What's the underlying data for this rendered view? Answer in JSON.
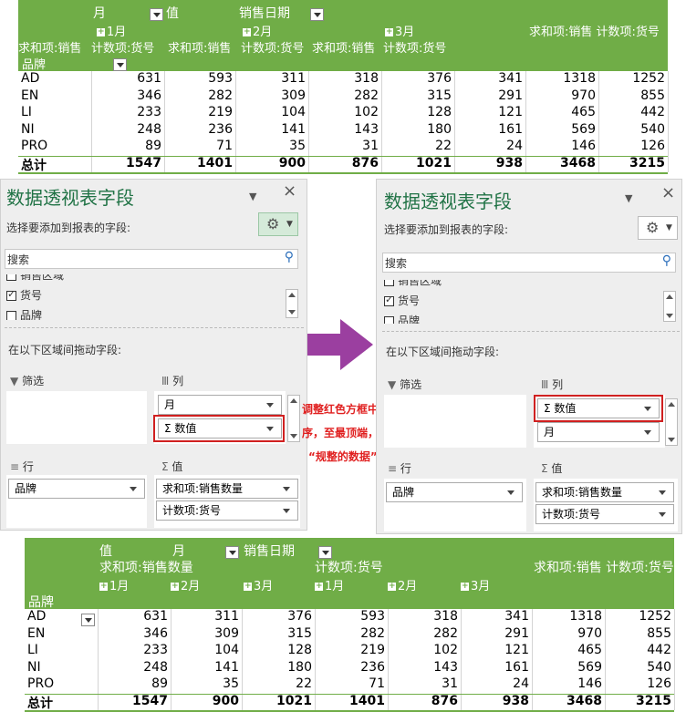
{
  "table1": {
    "header": {
      "month_label": "月",
      "value_label": "值",
      "date_label": "销售日期",
      "months": [
        "1月",
        "2月",
        "3月"
      ],
      "sub_sum": "求和项:销售",
      "sub_count": "计数项:货号",
      "total_sum_count": "求和项:销售 计数项:货号",
      "row_label": "品牌"
    },
    "rows": [
      {
        "brand": "AD",
        "values": [
          "631",
          "593",
          "311",
          "318",
          "376",
          "341",
          "1318",
          "1252"
        ]
      },
      {
        "brand": "EN",
        "values": [
          "346",
          "282",
          "309",
          "282",
          "315",
          "291",
          "970",
          "855"
        ]
      },
      {
        "brand": "LI",
        "values": [
          "233",
          "219",
          "104",
          "102",
          "128",
          "121",
          "465",
          "442"
        ]
      },
      {
        "brand": "NI",
        "values": [
          "248",
          "236",
          "141",
          "143",
          "180",
          "161",
          "569",
          "540"
        ]
      },
      {
        "brand": "PRO",
        "values": [
          "89",
          "71",
          "35",
          "31",
          "22",
          "24",
          "146",
          "126"
        ]
      }
    ],
    "total": {
      "label": "总计",
      "values": [
        "1547",
        "1401",
        "900",
        "876",
        "1021",
        "938",
        "3468",
        "3215"
      ]
    }
  },
  "panel_left": {
    "title": "数据透视表字段",
    "choose_label": "选择要添加到报表的字段:",
    "search_placeholder": "搜索",
    "fields": [
      "销售区域",
      "货号",
      "品牌"
    ],
    "drag_label": "在以下区域间拖动字段:",
    "filter_label": "筛选",
    "columns_label": "列",
    "rows_label": "行",
    "values_label": "值",
    "column_items": [
      "月",
      "Σ 数值"
    ],
    "row_items": [
      "品牌"
    ],
    "value_items": [
      "求和项:销售数量",
      "计数项:货号"
    ]
  },
  "panel_right": {
    "title": "数据透视表字段",
    "choose_label": "选择要添加到报表的字段:",
    "search_placeholder": "搜索",
    "fields": [
      "销售区域",
      "货号",
      "品牌"
    ],
    "drag_label": "在以下区域间拖动字段:",
    "filter_label": "筛选",
    "columns_label": "列",
    "rows_label": "行",
    "values_label": "值",
    "column_items": [
      "Σ 数值",
      "月"
    ],
    "row_items": [
      "品牌"
    ],
    "value_items": [
      "求和项:销售数量",
      "计数项:货号"
    ]
  },
  "annotation": {
    "line1": "调整红色方框中“数值”的顺",
    "line2": "序，至最顶端，就会得到下面",
    "line3": "“规整的数据”"
  },
  "table2": {
    "header": {
      "value_label": "值",
      "month_label": "月",
      "date_label": "销售日期",
      "sum_label": "求和项:销售数量",
      "count_label": "计数项:货号",
      "total_sum_count": "求和项:销售 计数项:货号",
      "months": [
        "1月",
        "2月",
        "3月",
        "1月",
        "2月",
        "3月"
      ],
      "row_label": "品牌"
    },
    "rows": [
      {
        "brand": "AD",
        "values": [
          "631",
          "311",
          "376",
          "593",
          "318",
          "341",
          "1318",
          "1252"
        ]
      },
      {
        "brand": "EN",
        "values": [
          "346",
          "309",
          "315",
          "282",
          "282",
          "291",
          "970",
          "855"
        ]
      },
      {
        "brand": "LI",
        "values": [
          "233",
          "104",
          "128",
          "219",
          "102",
          "121",
          "465",
          "442"
        ]
      },
      {
        "brand": "NI",
        "values": [
          "248",
          "141",
          "180",
          "236",
          "143",
          "161",
          "569",
          "540"
        ]
      },
      {
        "brand": "PRO",
        "values": [
          "89",
          "35",
          "22",
          "71",
          "31",
          "24",
          "146",
          "126"
        ]
      }
    ],
    "total": {
      "label": "总计",
      "values": [
        "1547",
        "900",
        "1021",
        "1401",
        "876",
        "938",
        "3468",
        "3215"
      ]
    }
  },
  "colors": {
    "header_green": "#70ad47",
    "title_green": "#217346",
    "annotation_red": "#e02020",
    "arrow_purple": "#9b3fa0"
  }
}
